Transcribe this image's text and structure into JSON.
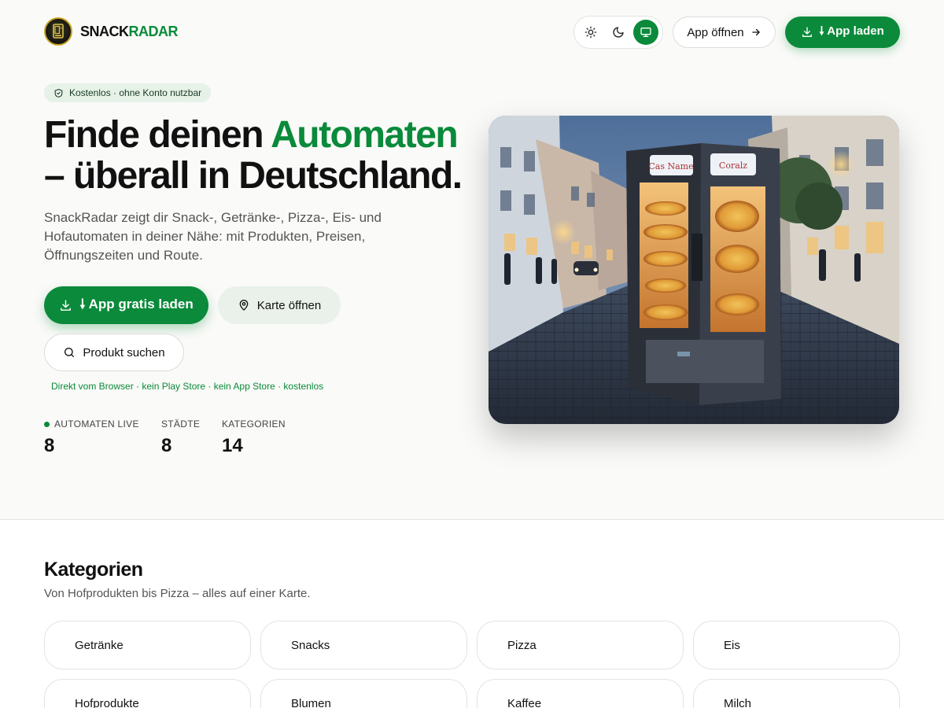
{
  "brand": {
    "name_part1": "SNACK",
    "name_part2": "RADAR",
    "logo_icon": "vending-machine-logo"
  },
  "header": {
    "theme_options": [
      {
        "name": "light",
        "icon": "sun-icon"
      },
      {
        "name": "dark",
        "icon": "moon-icon"
      },
      {
        "name": "system",
        "icon": "monitor-icon",
        "active": true
      }
    ],
    "open_app_label": "App öffnen",
    "load_app_label": "🠗 App laden"
  },
  "hero": {
    "badge": "Kostenlos · ohne Konto nutzbar",
    "title_part1": "Finde deinen ",
    "title_highlight": "Automaten",
    "title_part2": "– überall in Deutschland.",
    "description": "SnackRadar zeigt dir Snack-, Getränke-, Pizza-, Eis- und Hofautomaten in deiner Nähe: mit Produkten, Preisen, Öffnungszeiten und Route.",
    "cta_primary": "🠗 App gratis laden",
    "cta_map": "Karte öffnen",
    "cta_search": "Produkt suchen",
    "browser_note": "Direkt vom Browser · kein Play Store · kein App Store · kostenlos",
    "image_signs": [
      "Cas Name",
      "Coralz"
    ]
  },
  "stats": [
    {
      "label": "AUTOMATEN LIVE",
      "value": "8",
      "live": true
    },
    {
      "label": "STÄDTE",
      "value": "8"
    },
    {
      "label": "KATEGORIEN",
      "value": "14"
    }
  ],
  "categories": {
    "title": "Kategorien",
    "subtitle": "Von Hofprodukten bis Pizza – alles auf einer Karte.",
    "items": [
      "Getränke",
      "Snacks",
      "Pizza",
      "Eis",
      "Hofprodukte",
      "Blumen",
      "Kaffee",
      "Milch"
    ]
  },
  "colors": {
    "accent": "#0a8a3a",
    "background": "#fafaf8",
    "text": "#111111"
  }
}
